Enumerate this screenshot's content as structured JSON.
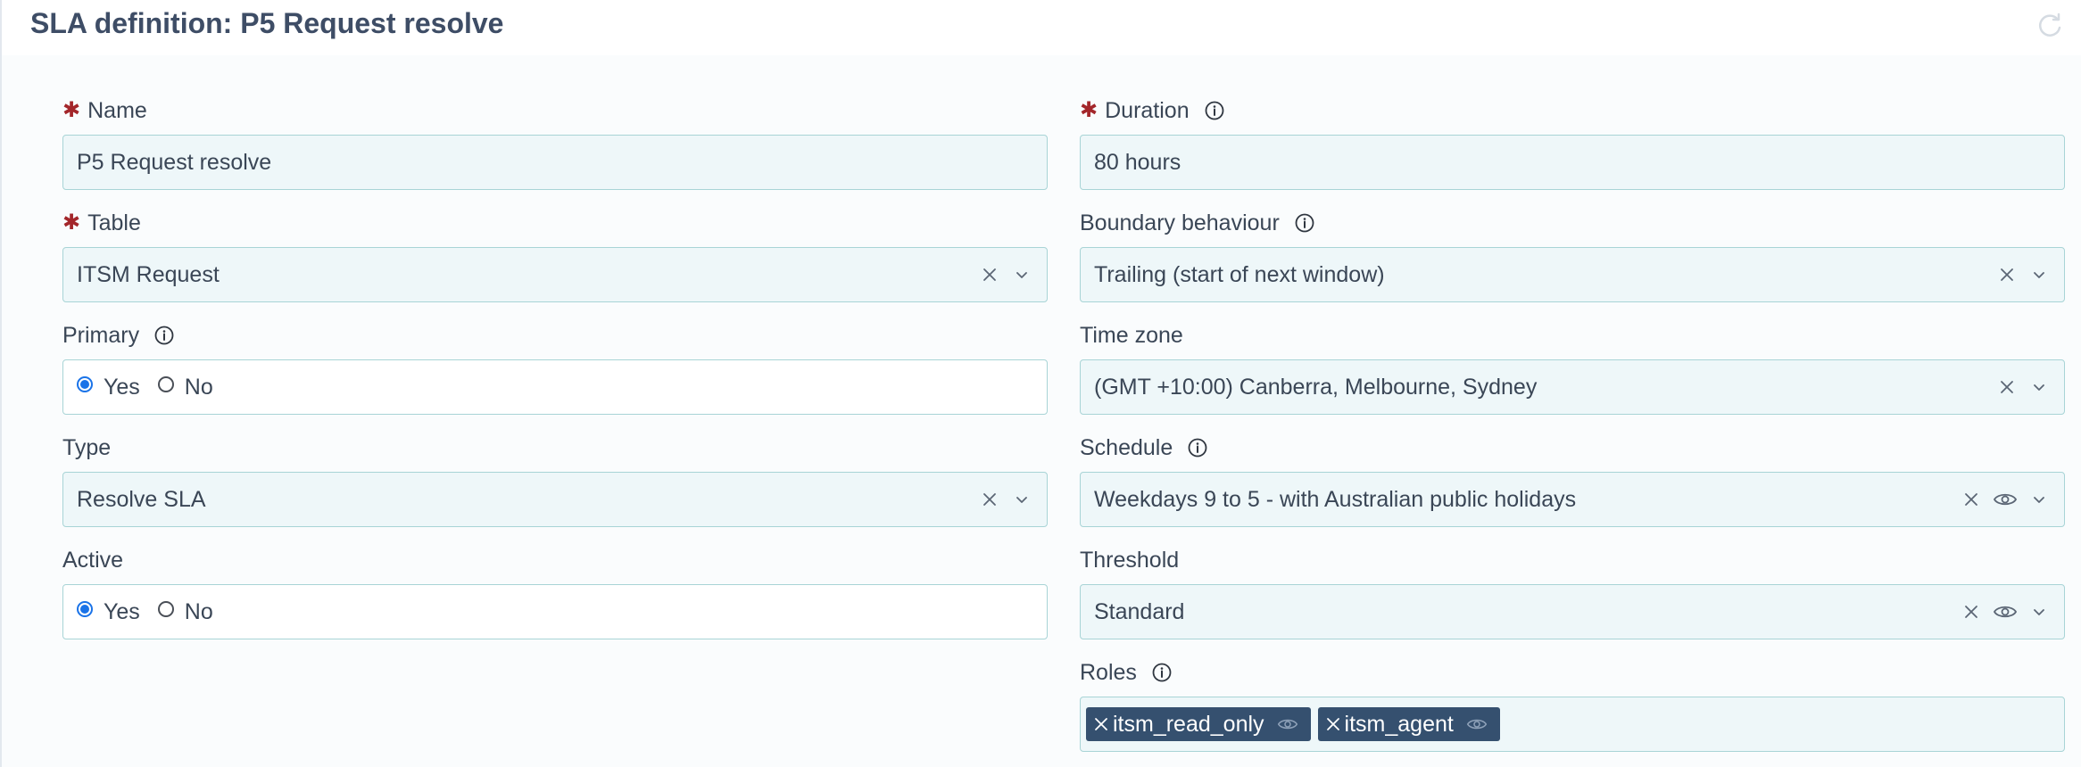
{
  "page": {
    "title": "SLA definition: P5 Request resolve"
  },
  "left_fields": {
    "name": {
      "label": "Name",
      "required": true,
      "value": "P5 Request resolve"
    },
    "table": {
      "label": "Table",
      "required": true,
      "value": "ITSM Request"
    },
    "primary": {
      "label": "Primary",
      "options": [
        "Yes",
        "No"
      ],
      "selected": "Yes"
    },
    "type": {
      "label": "Type",
      "value": "Resolve SLA"
    },
    "active": {
      "label": "Active",
      "options": [
        "Yes",
        "No"
      ],
      "selected": "Yes"
    }
  },
  "right_fields": {
    "duration": {
      "label": "Duration",
      "required": true,
      "value": "80 hours"
    },
    "boundary": {
      "label": "Boundary behaviour",
      "value": "Trailing (start of next window)"
    },
    "timezone": {
      "label": "Time zone",
      "value": "(GMT +10:00) Canberra, Melbourne, Sydney"
    },
    "schedule": {
      "label": "Schedule",
      "value": "Weekdays 9 to 5 - with Australian public holidays"
    },
    "threshold": {
      "label": "Threshold",
      "value": "Standard"
    },
    "roles": {
      "label": "Roles",
      "tags": [
        "itsm_read_only",
        "itsm_agent"
      ]
    }
  },
  "icons": {
    "required": "asterisk-icon",
    "info": "info-icon",
    "clear": "close-icon",
    "dropdown": "chevron-down-icon",
    "view": "eye-icon",
    "refresh": "refresh-icon"
  },
  "colors": {
    "title": "#3e4d66",
    "required": "#a3262a",
    "field_border": "#a8d4d6",
    "field_bg": "#eef7f9",
    "chip_bg": "#35506f",
    "radio_selected": "#1a73e8"
  }
}
